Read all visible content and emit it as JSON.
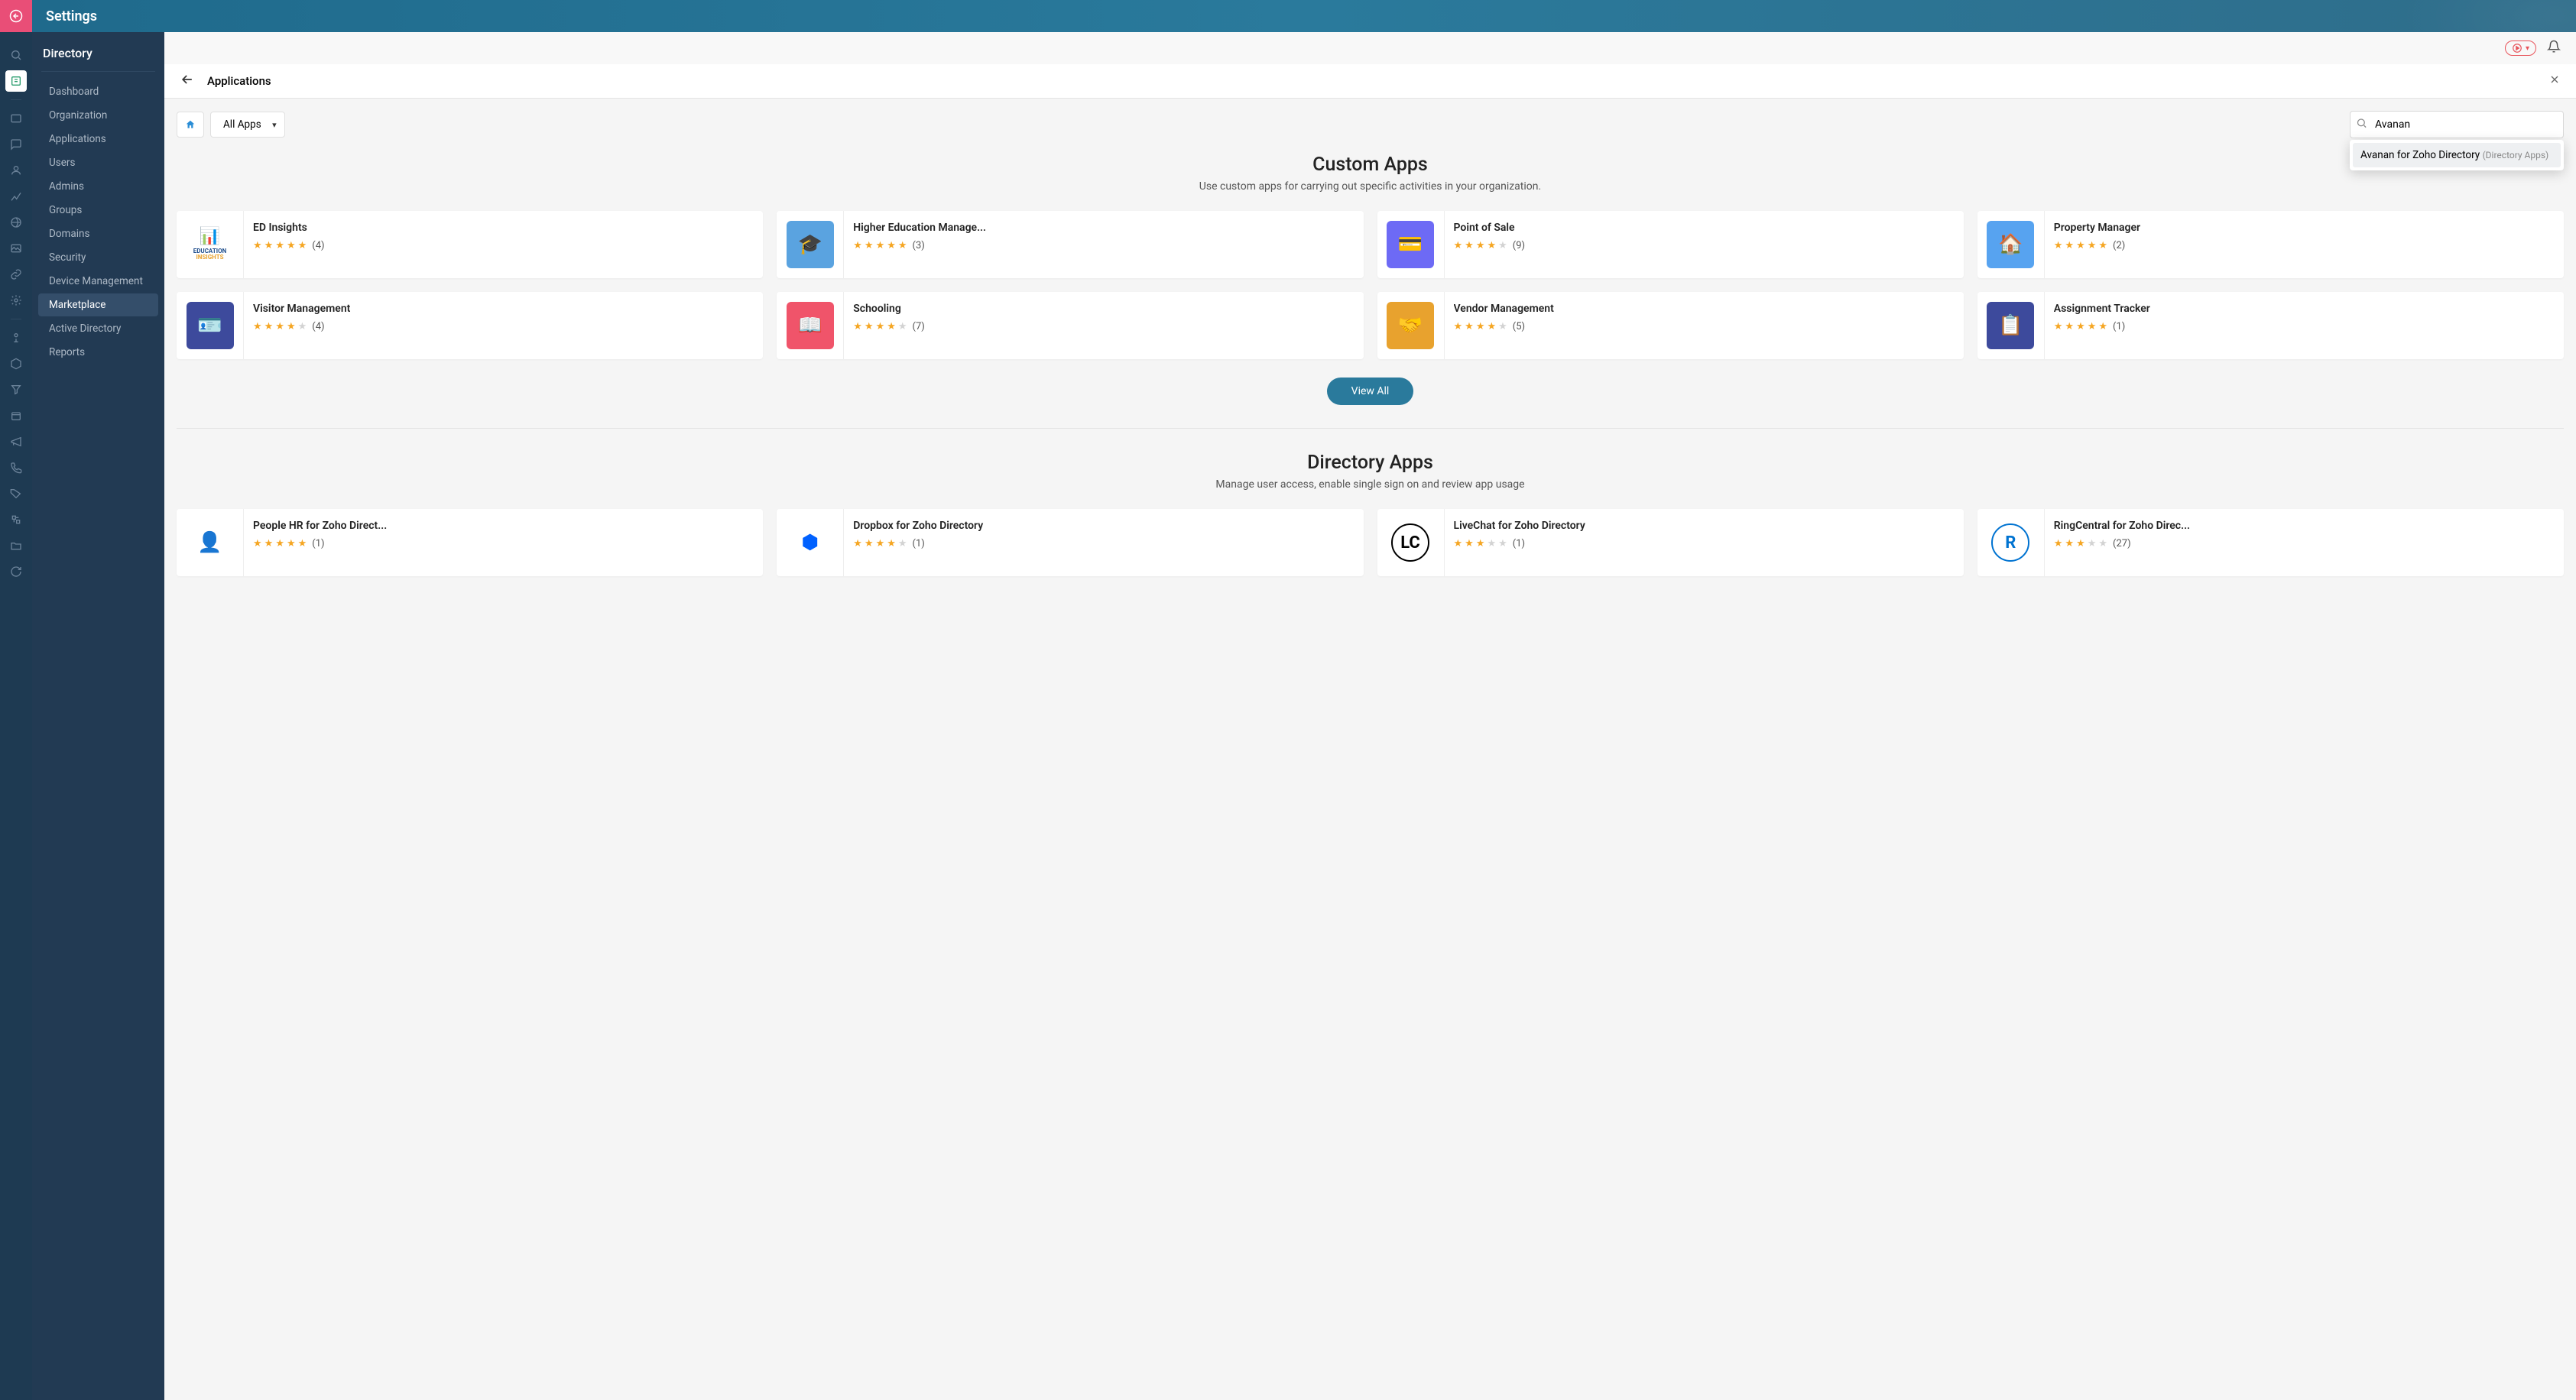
{
  "header": {
    "title": "Settings"
  },
  "sidebar": {
    "title": "Directory",
    "items": [
      {
        "label": "Dashboard"
      },
      {
        "label": "Organization"
      },
      {
        "label": "Applications"
      },
      {
        "label": "Users"
      },
      {
        "label": "Admins"
      },
      {
        "label": "Groups"
      },
      {
        "label": "Domains"
      },
      {
        "label": "Security"
      },
      {
        "label": "Device Management"
      },
      {
        "label": "Marketplace",
        "active": true
      },
      {
        "label": "Active Directory"
      },
      {
        "label": "Reports"
      }
    ]
  },
  "page": {
    "title": "Applications",
    "filter": "All Apps"
  },
  "search": {
    "value": "Avanan",
    "suggestion": {
      "label": "Avanan for Zoho Directory",
      "meta": "(Directory Apps)"
    }
  },
  "sections": [
    {
      "title": "Custom Apps",
      "subtitle": "Use custom apps for carrying out specific activities in your organization.",
      "view_all": "View All",
      "cards": [
        {
          "title": "ED Insights",
          "stars": 5,
          "count": "(4)",
          "iconBg": "#ffffff",
          "iconColor": "#1f4e8c",
          "emoji": "📊",
          "label": "EDUCATION INSIGHTS"
        },
        {
          "title": "Higher Education Manage...",
          "stars": 5,
          "count": "(3)",
          "iconBg": "#5aa3e0",
          "emoji": "🎓"
        },
        {
          "title": "Point of Sale",
          "stars": 4,
          "count": "(9)",
          "iconBg": "#6d6af5",
          "emoji": "💳"
        },
        {
          "title": "Property Manager",
          "stars": 5,
          "count": "(2)",
          "iconBg": "#57a3f0",
          "emoji": "🏠"
        },
        {
          "title": "Visitor Management",
          "stars": 4,
          "count": "(4)",
          "iconBg": "#3d4a9c",
          "emoji": "🪪"
        },
        {
          "title": "Schooling",
          "stars": 4,
          "count": "(7)",
          "iconBg": "#f0546a",
          "emoji": "📖"
        },
        {
          "title": "Vendor Management",
          "stars": 4,
          "count": "(5)",
          "iconBg": "#e8a22e",
          "emoji": "🤝"
        },
        {
          "title": "Assignment Tracker",
          "stars": 5,
          "count": "(1)",
          "iconBg": "#3d4a9c",
          "emoji": "📋"
        }
      ]
    },
    {
      "title": "Directory Apps",
      "subtitle": "Manage user access, enable single sign on and review app usage",
      "cards": [
        {
          "title": "People HR for Zoho Direct...",
          "stars": 5,
          "count": "(1)",
          "iconBg": "#ffffff",
          "iconColor": "#f08a3c",
          "emoji": "👤"
        },
        {
          "title": "Dropbox for Zoho Directory",
          "stars": 4,
          "count": "(1)",
          "iconBg": "#ffffff",
          "iconColor": "#0061ff",
          "emoji": "⬢"
        },
        {
          "title": "LiveChat for Zoho Directory",
          "stars": 3,
          "count": "(1)",
          "iconBg": "#ffffff",
          "iconColor": "#000",
          "emoji": "💬",
          "text": "LC"
        },
        {
          "title": "RingCentral for Zoho Direc...",
          "stars": 3,
          "count": "(27)",
          "iconBg": "#ffffff",
          "iconColor": "#0073d1",
          "emoji": "®",
          "text": "R"
        }
      ]
    }
  ]
}
